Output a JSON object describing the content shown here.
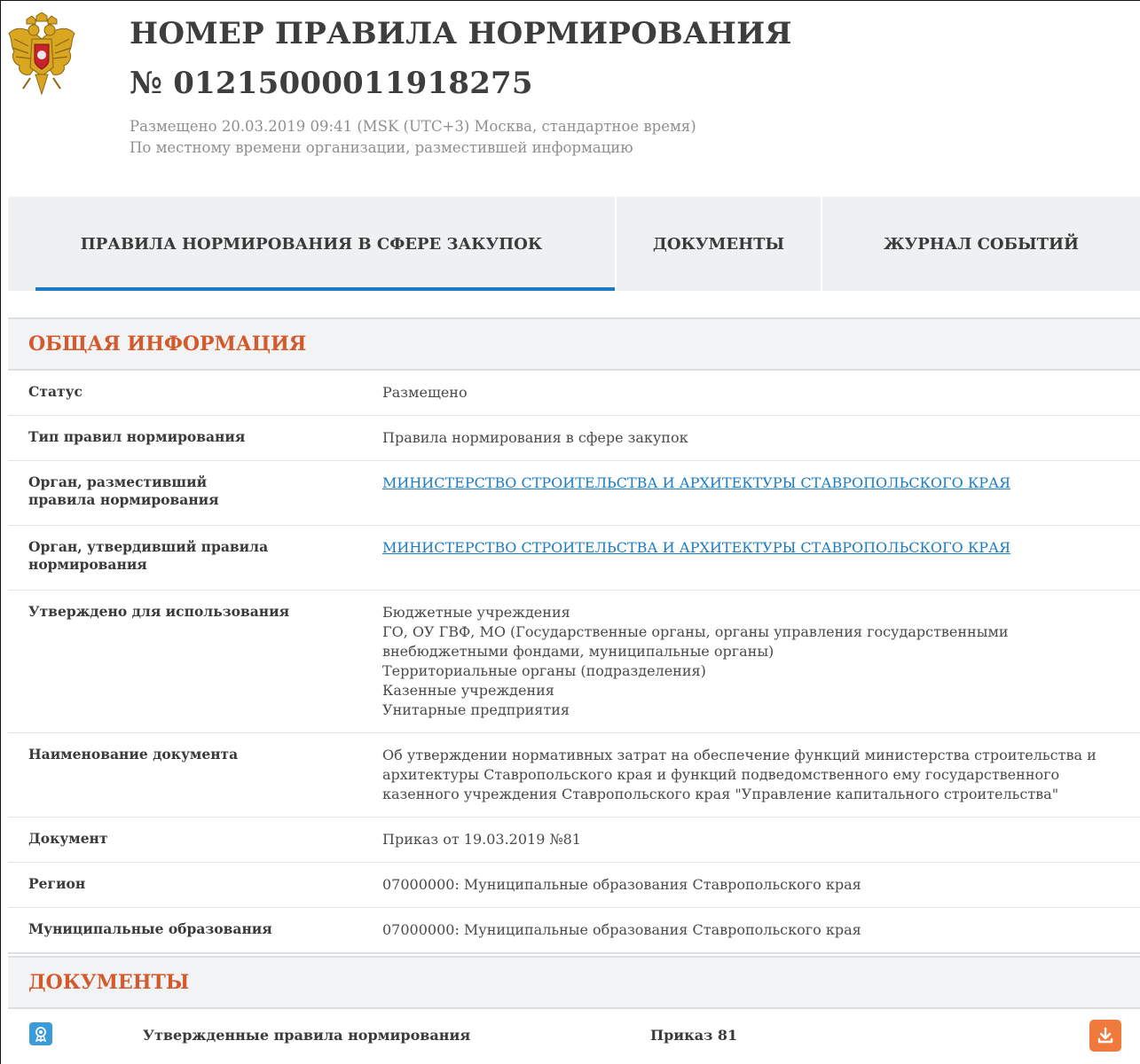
{
  "header": {
    "title_line1": "НОМЕР ПРАВИЛА НОРМИРОВАНИЯ",
    "title_line2": "№ 01215000011918275",
    "posted": "Размещено 20.03.2019 09:41 (MSK (UTC+3) Москва, стандартное время)",
    "local_time_note": "По местному времени организации, разместившей информацию",
    "emblem_icon": "russian-coat-of-arms-icon"
  },
  "tabs": [
    {
      "label": "ПРАВИЛА НОРМИРОВАНИЯ В СФЕРЕ ЗАКУПОК",
      "active": true
    },
    {
      "label": "ДОКУМЕНТЫ",
      "active": false
    },
    {
      "label": "ЖУРНАЛ СОБЫТИЙ",
      "active": false
    }
  ],
  "general": {
    "heading": "ОБЩАЯ ИНФОРМАЦИЯ",
    "rows": {
      "status": {
        "label": "Статус",
        "value": "Размещено"
      },
      "rule_type": {
        "label": "Тип правил нормирования",
        "value": "Правила нормирования в сфере закупок"
      },
      "posted_by": {
        "label": "Орган, разместивший правила нормирования",
        "value": "МИНИСТЕРСТВО СТРОИТЕЛЬСТВА И АРХИТЕКТУРЫ СТАВРОПОЛЬСКОГО КРАЯ"
      },
      "approved_by": {
        "label": "Орган, утвердивший правила нормирования",
        "value": "МИНИСТЕРСТВО СТРОИТЕЛЬСТВА И АРХИТЕКТУРЫ СТАВРОПОЛЬСКОГО КРАЯ"
      },
      "approved_for": {
        "label": "Утверждено для использования",
        "values": [
          "Бюджетные учреждения",
          "ГО, ОУ ГВФ, МО (Государственные органы, органы управления государственными внебюджетными фондами, муниципальные органы)",
          "Территориальные органы (подразделения)",
          "Казенные учреждения",
          "Унитарные предприятия"
        ]
      },
      "doc_name": {
        "label": "Наименование документа",
        "value": "Об утверждении нормативных затрат на обеспечение функций министерства строительства и архитектуры Ставропольского края и функций подведомственного ему государственного казенного учреждения Ставропольского края \"Управление капитального строительства\""
      },
      "document": {
        "label": "Документ",
        "value": "Приказ от 19.03.2019 №81"
      },
      "region": {
        "label": "Регион",
        "value": "07000000: Муниципальные образования Ставропольского края"
      },
      "municipal": {
        "label": "Муниципальные образования",
        "value": "07000000: Муниципальные образования Ставропольского края"
      }
    }
  },
  "documents": {
    "heading": "ДОКУМЕНТЫ",
    "items": [
      {
        "type_icon": "certificate-icon",
        "title": "Утвержденные правила нормирования",
        "name": "Приказ 81",
        "action_icon": "download-icon"
      }
    ]
  },
  "colors": {
    "accent": "#1d7cc1",
    "section_heading": "#d35a2c",
    "download": "#ef7a3c",
    "doc_icon": "#3b9ad9"
  }
}
